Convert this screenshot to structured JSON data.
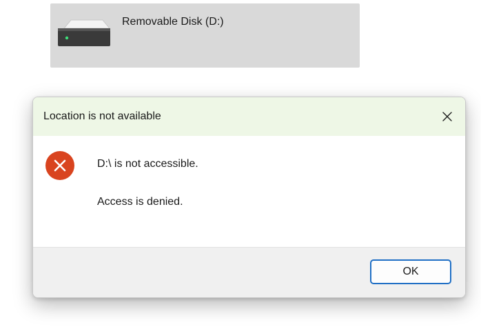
{
  "drive": {
    "label": "Removable Disk (D:)",
    "icon": "removable-drive-icon"
  },
  "dialog": {
    "title": "Location is not available",
    "close_icon": "close-icon",
    "error_icon": "error-icon",
    "message_line1": "D:\\ is not accessible.",
    "message_line2": "Access is denied.",
    "ok_label": "OK"
  },
  "colors": {
    "title_bar": "#eef7e6",
    "error_red": "#d9441f",
    "ok_border": "#1f6fc5",
    "footer_bg": "#f0f0f0",
    "drive_tile_bg": "#d9d9d9"
  }
}
